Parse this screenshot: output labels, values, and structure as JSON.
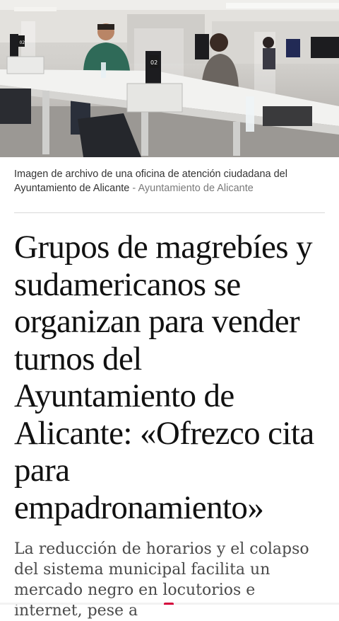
{
  "article": {
    "image": {
      "caption": "Imagen de archivo de una oficina de atención ciudadana del Ayuntamiento de Alicante",
      "separator": " - ",
      "credit": "Ayuntamiento de Alicante",
      "desk_number_1": "02",
      "desk_number_2": "02"
    },
    "headline": "Grupos de magrebíes y sudamericanos se organizan para vender turnos del Ayuntamiento de Alicante: «Ofrezco cita para empadronamiento»",
    "subheadline": "La reducción de horarios y el colapso del sistema municipal facilita un mercado negro en locutorios e internet, pese a"
  },
  "colors": {
    "accent": "#d4003a",
    "caption_credit": "#7a7a7a",
    "subheadline": "#4a4a4a"
  }
}
